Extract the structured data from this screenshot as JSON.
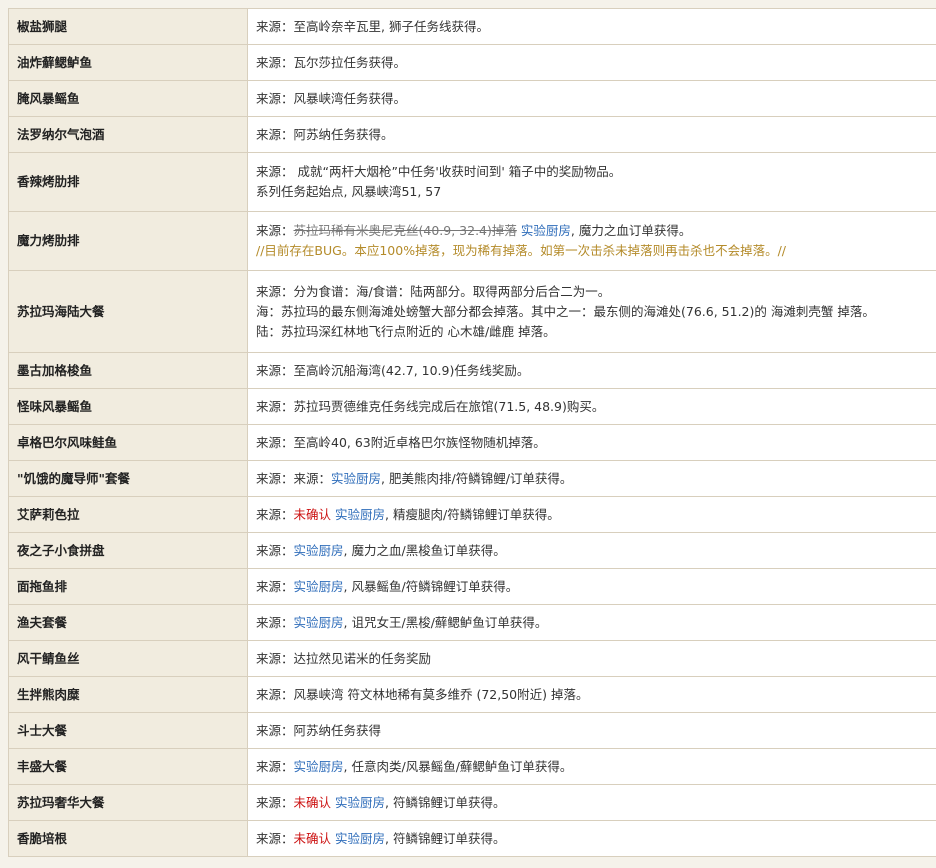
{
  "rows": [
    {
      "name": "椒盐狮腿",
      "lines": [
        [
          {
            "t": "来源：至高岭奈辛瓦里, 狮子任务线获得。"
          }
        ]
      ]
    },
    {
      "name": "油炸蘚鳃鲈鱼",
      "lines": [
        [
          {
            "t": "来源：瓦尔莎拉任务获得。"
          }
        ]
      ]
    },
    {
      "name": "腌风暴鳐鱼",
      "lines": [
        [
          {
            "t": "来源：风暴峡湾任务获得。"
          }
        ]
      ]
    },
    {
      "name": "法罗纳尔气泡酒",
      "lines": [
        [
          {
            "t": "来源：阿苏纳任务获得。"
          }
        ]
      ]
    },
    {
      "name": "香辣烤肋排",
      "lines": [
        [
          {
            "t": "来源： 成就“两杆大烟枪”中任务'收获时间到' 箱子中的奖励物品。"
          }
        ],
        [
          {
            "t": "系列任务起始点, 风暴峡湾51, 57"
          }
        ]
      ]
    },
    {
      "name": "魔力烤肋排",
      "lines": [
        [
          {
            "t": "来源："
          },
          {
            "t": "苏拉玛稀有米奥尼克丝(40.9, 32.4)掉落",
            "s": "strike"
          },
          {
            "t": " "
          },
          {
            "t": "实验厨房",
            "s": "link"
          },
          {
            "t": ", 魔力之血订单获得。"
          }
        ],
        [
          {
            "t": "//目前存在BUG。本应100%掉落，现为稀有掉落。如第一次击杀未掉落则再击杀也不会掉落。//",
            "s": "bug"
          }
        ]
      ]
    },
    {
      "name": "苏拉玛海陆大餐",
      "lines": [
        [
          {
            "t": "来源：分为食谱：海/食谱：陆两部分。取得两部分后合二为一。"
          }
        ],
        [
          {
            "t": "海：苏拉玛的最东侧海滩处螃蟹大部分都会掉落。其中之一：最东侧的海滩处(76.6, 51.2)的 海滩刺壳蟹 掉落。"
          }
        ],
        [
          {
            "t": "陆：苏拉玛深红林地飞行点附近的 心木雄/雌鹿 掉落。"
          }
        ]
      ]
    },
    {
      "name": "墨古加格梭鱼",
      "lines": [
        [
          {
            "t": "来源：至高岭沉船海湾(42.7, 10.9)任务线奖励。"
          }
        ]
      ]
    },
    {
      "name": "怪味风暴鳐鱼",
      "lines": [
        [
          {
            "t": "来源：苏拉玛贾德维克任务线完成后在旅馆(71.5, 48.9)购买。"
          }
        ]
      ]
    },
    {
      "name": "卓格巴尔风味鲑鱼",
      "lines": [
        [
          {
            "t": "来源：至高岭40, 63附近卓格巴尔族怪物随机掉落。"
          }
        ]
      ]
    },
    {
      "name": "\"饥饿的魔导师\"套餐",
      "lines": [
        [
          {
            "t": "来源：来源："
          },
          {
            "t": "实验厨房",
            "s": "link"
          },
          {
            "t": ", 肥美熊肉排/符鳞锦鲤/订单获得。"
          }
        ]
      ]
    },
    {
      "name": "艾萨莉色拉",
      "lines": [
        [
          {
            "t": "来源："
          },
          {
            "t": "未确认",
            "s": "red"
          },
          {
            "t": " "
          },
          {
            "t": "实验厨房",
            "s": "link"
          },
          {
            "t": ", 精瘦腿肉/符鳞锦鲤订单获得。"
          }
        ]
      ]
    },
    {
      "name": "夜之子小食拼盘",
      "lines": [
        [
          {
            "t": "来源："
          },
          {
            "t": "实验厨房",
            "s": "link"
          },
          {
            "t": ", 魔力之血/黑梭鱼订单获得。"
          }
        ]
      ]
    },
    {
      "name": "面拖鱼排",
      "lines": [
        [
          {
            "t": "来源："
          },
          {
            "t": "实验厨房",
            "s": "link"
          },
          {
            "t": ", 风暴鳐鱼/符鳞锦鲤订单获得。"
          }
        ]
      ]
    },
    {
      "name": "渔夫套餐",
      "lines": [
        [
          {
            "t": "来源："
          },
          {
            "t": "实验厨房",
            "s": "link"
          },
          {
            "t": ", 诅咒女王/黑梭/蘚鳃鲈鱼订单获得。"
          }
        ]
      ]
    },
    {
      "name": "风干鲭鱼丝",
      "lines": [
        [
          {
            "t": "来源：达拉然见诺米的任务奖励"
          }
        ]
      ]
    },
    {
      "name": "生拌熊肉糜",
      "lines": [
        [
          {
            "t": "来源：风暴峡湾 符文林地稀有莫多维乔 (72,50附近) 掉落。"
          }
        ]
      ]
    },
    {
      "name": "斗士大餐",
      "lines": [
        [
          {
            "t": "来源：阿苏纳任务获得"
          }
        ]
      ]
    },
    {
      "name": "丰盛大餐",
      "lines": [
        [
          {
            "t": "来源："
          },
          {
            "t": "实验厨房",
            "s": "link"
          },
          {
            "t": ", 任意肉类/风暴鳐鱼/蘚鳃鲈鱼订单获得。"
          }
        ]
      ]
    },
    {
      "name": "苏拉玛奢华大餐",
      "lines": [
        [
          {
            "t": "来源："
          },
          {
            "t": "未确认",
            "s": "red"
          },
          {
            "t": " "
          },
          {
            "t": "实验厨房",
            "s": "link"
          },
          {
            "t": ", 符鳞锦鲤订单获得。"
          }
        ]
      ]
    },
    {
      "name": "香脆培根",
      "lines": [
        [
          {
            "t": "来源："
          },
          {
            "t": "未确认",
            "s": "red"
          },
          {
            "t": " "
          },
          {
            "t": "实验厨房",
            "s": "link"
          },
          {
            "t": ", 符鳞锦鲤订单获得。"
          }
        ]
      ]
    }
  ]
}
